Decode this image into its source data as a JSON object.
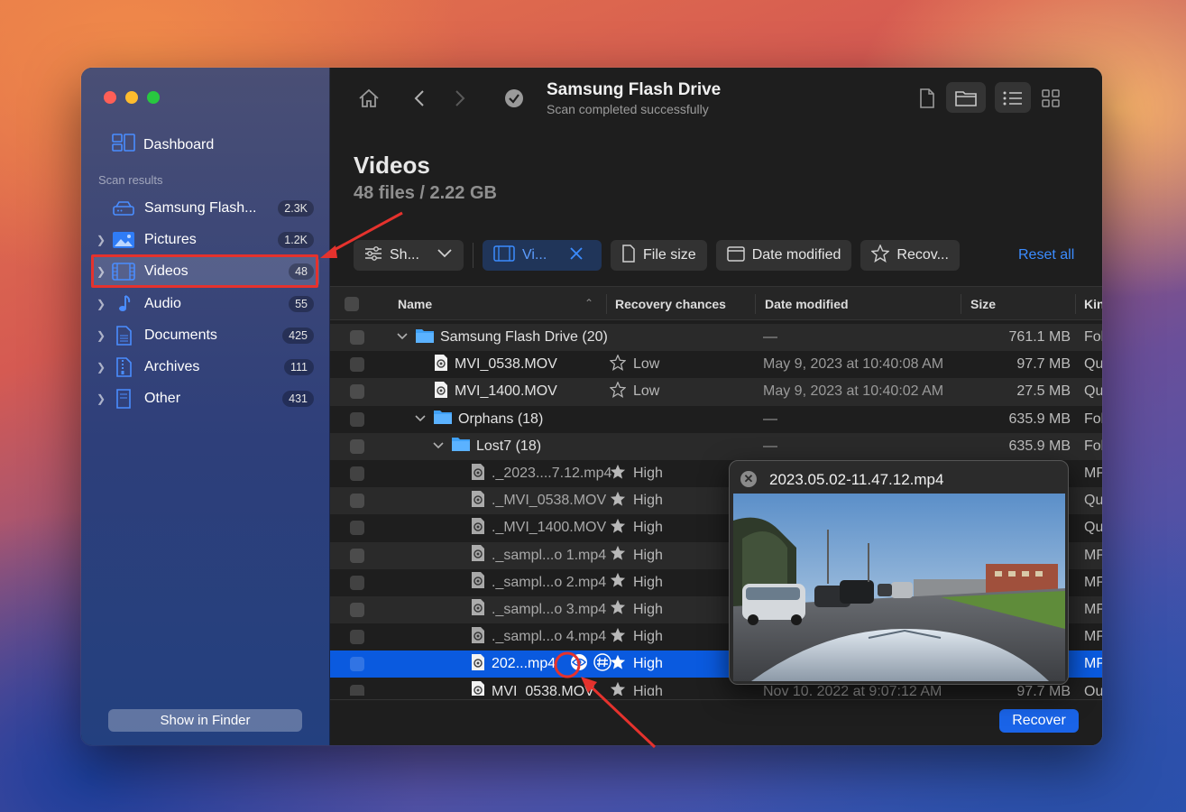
{
  "sidebar": {
    "dashboard_label": "Dashboard",
    "section_label": "Scan results",
    "items": [
      {
        "label": "Samsung Flash...",
        "count": "2.3K",
        "icon": "drive-icon",
        "expandable": false
      },
      {
        "label": "Pictures",
        "count": "1.2K",
        "icon": "picture-icon",
        "expandable": true
      },
      {
        "label": "Videos",
        "count": "48",
        "icon": "film-icon",
        "expandable": true,
        "active": true
      },
      {
        "label": "Audio",
        "count": "55",
        "icon": "music-note-icon",
        "expandable": true
      },
      {
        "label": "Documents",
        "count": "425",
        "icon": "document-icon",
        "expandable": true
      },
      {
        "label": "Archives",
        "count": "111",
        "icon": "archive-icon",
        "expandable": true
      },
      {
        "label": "Other",
        "count": "431",
        "icon": "file-icon",
        "expandable": true
      }
    ],
    "show_in_finder_label": "Show in Finder"
  },
  "toolbar": {
    "title": "Samsung Flash Drive",
    "subtitle": "Scan completed successfully"
  },
  "header": {
    "title": "Videos",
    "subtitle": "48 files / 2.22 GB"
  },
  "filters": {
    "show_label": "Sh...",
    "kind_label": "Vi...",
    "file_size_label": "File size",
    "date_modified_label": "Date modified",
    "recovery_label": "Recov...",
    "reset_label": "Reset all"
  },
  "table": {
    "columns": {
      "name": "Name",
      "recovery": "Recovery chances",
      "date": "Date modified",
      "size": "Size",
      "kind": "Kin"
    },
    "rows": [
      {
        "name": "Samsung Flash Drive (20)",
        "indent": 0,
        "type": "folder",
        "chevron": "v",
        "chance": "",
        "date": "—",
        "size": "761.1 MB",
        "kind": "Fol"
      },
      {
        "name": "MVI_0538.MOV",
        "indent": 1,
        "type": "file",
        "chevron": "",
        "chance": "Low",
        "chance_filled": false,
        "date": "May 9, 2023 at 10:40:08 AM",
        "size": "97.7 MB",
        "kind": "Qu"
      },
      {
        "name": "MVI_1400.MOV",
        "indent": 1,
        "type": "file",
        "chevron": "",
        "chance": "Low",
        "chance_filled": false,
        "date": "May 9, 2023 at 10:40:02 AM",
        "size": "27.5 MB",
        "kind": "Qu"
      },
      {
        "name": "Orphans (18)",
        "indent": 1,
        "type": "folder",
        "chevron": "v",
        "chance": "",
        "date": "—",
        "size": "635.9 MB",
        "kind": "Fol"
      },
      {
        "name": "Lost7 (18)",
        "indent": 2,
        "type": "folder",
        "chevron": "v",
        "chance": "",
        "date": "—",
        "size": "635.9 MB",
        "kind": "Fol"
      },
      {
        "name": "._2023....7.12.mp4",
        "indent": 3,
        "type": "file-dim",
        "chevron": "",
        "chance": "High",
        "chance_filled": true,
        "date": "",
        "size": "",
        "kind": "MP"
      },
      {
        "name": "._MVI_0538.MOV",
        "indent": 3,
        "type": "file-dim",
        "chevron": "",
        "chance": "High",
        "chance_filled": true,
        "date": "",
        "size": "",
        "kind": "Qu"
      },
      {
        "name": "._MVI_1400.MOV",
        "indent": 3,
        "type": "file-dim",
        "chevron": "",
        "chance": "High",
        "chance_filled": true,
        "date": "",
        "size": "",
        "kind": "Qu"
      },
      {
        "name": "._sampl...o 1.mp4",
        "indent": 3,
        "type": "file-dim",
        "chevron": "",
        "chance": "High",
        "chance_filled": true,
        "date": "",
        "size": "",
        "kind": "MP"
      },
      {
        "name": "._sampl...o 2.mp4",
        "indent": 3,
        "type": "file-dim",
        "chevron": "",
        "chance": "High",
        "chance_filled": true,
        "date": "",
        "size": "",
        "kind": "MP"
      },
      {
        "name": "._sampl...o 3.mp4",
        "indent": 3,
        "type": "file-dim",
        "chevron": "",
        "chance": "High",
        "chance_filled": true,
        "date": "",
        "size": "",
        "kind": "MP"
      },
      {
        "name": "._sampl...o 4.mp4",
        "indent": 3,
        "type": "file-dim",
        "chevron": "",
        "chance": "High",
        "chance_filled": true,
        "date": "",
        "size": "",
        "kind": "MP"
      },
      {
        "name": "202...mp4",
        "indent": 3,
        "type": "file",
        "chevron": "",
        "chance": "High",
        "chance_filled": true,
        "date": "",
        "size": "",
        "kind": "MP",
        "selected": true
      },
      {
        "name": "MVI_0538.MOV",
        "indent": 3,
        "type": "file",
        "chevron": "",
        "chance": "High",
        "chance_filled": true,
        "date": "Nov 10, 2022 at 9:07:12 AM",
        "size": "97.7 MB",
        "kind": "Qu"
      }
    ]
  },
  "preview": {
    "title": "2023.05.02-11.47.12.mp4"
  },
  "recover_label": "Recover",
  "colors": {
    "accent": "#0a5adf",
    "annotation": "#e5322d",
    "link": "#3b8cff"
  }
}
